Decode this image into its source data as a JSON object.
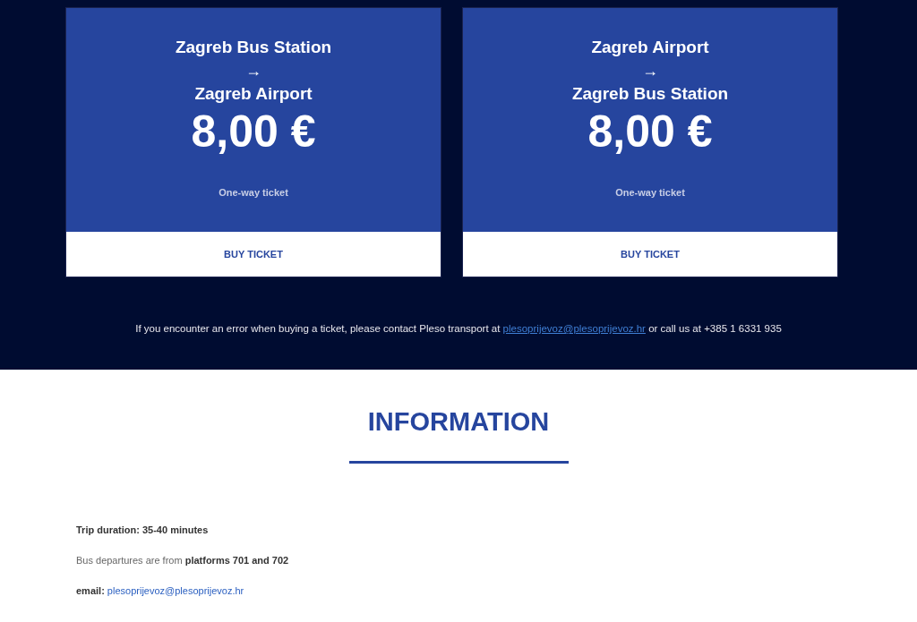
{
  "tickets": [
    {
      "from": "Zagreb Bus Station",
      "arrow": "→",
      "to": "Zagreb Airport",
      "price": "8,00 €",
      "note": "One-way ticket",
      "button": "BUY TICKET"
    },
    {
      "from": "Zagreb Airport",
      "arrow": "→",
      "to": "Zagreb Bus Station",
      "price": "8,00 €",
      "note": "One-way ticket",
      "button": "BUY TICKET"
    }
  ],
  "notice": {
    "before": "If you encounter an error when buying a ticket, please contact Pleso transport at",
    "link": "plesoprijevoz@plesoprijevoz.hr",
    "after": "or call us at +385 1 6331 935"
  },
  "information": {
    "heading": "INFORMATION",
    "items": [
      {
        "kind": "bold",
        "text": "**Trip duration: 35-40 minutes**"
      },
      {
        "kind": "text",
        "text": "Bus departures are from **platforms 701 and 702**"
      },
      {
        "kind": "email",
        "label": "email:",
        "link": "plesoprijevoz@plesoprijevoz.hr"
      }
    ]
  }
}
